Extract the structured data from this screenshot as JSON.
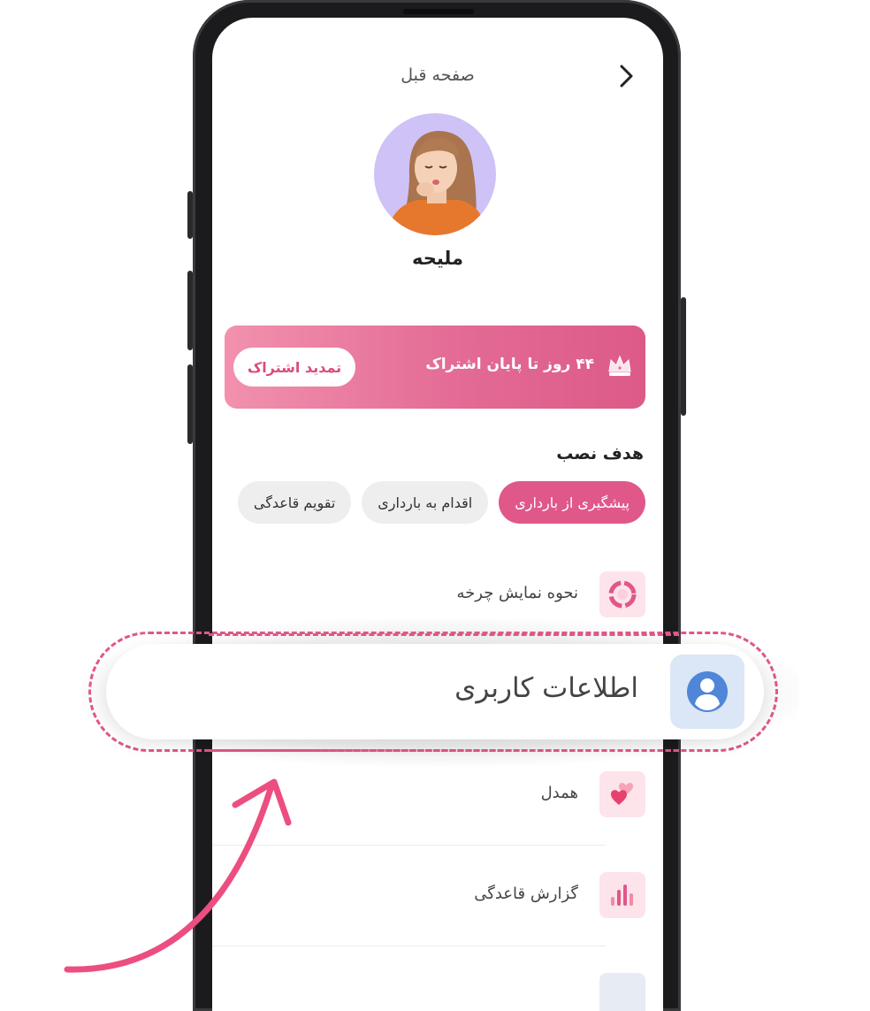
{
  "header": {
    "back_label": "صفحه قبل"
  },
  "profile": {
    "name": "ملیحه"
  },
  "subscription": {
    "status_text": "۴۴ روز تا پایان اشتراک",
    "renew_label": "تمدید اشتراک"
  },
  "goal": {
    "title": "هدف نصب",
    "chips": [
      {
        "label": "پیشگیری از بارداری",
        "active": true
      },
      {
        "label": "اقدام به بارداری",
        "active": false
      },
      {
        "label": "تقویم قاعدگی",
        "active": false
      }
    ]
  },
  "menu": {
    "items": [
      {
        "label": "نحوه نمایش چرخه",
        "icon": "cycle-icon"
      },
      {
        "label": "اطلاعات کاربری",
        "icon": "user-icon"
      },
      {
        "label": "همدل",
        "icon": "hearts-icon"
      },
      {
        "label": "گزارش قاعدگی",
        "icon": "bar-chart-icon"
      }
    ]
  },
  "colors": {
    "accent": "#e0578a",
    "banner_start": "#f291ae",
    "banner_end": "#dd5a88",
    "user_icon_bg": "#dbe6f7",
    "user_icon": "#4f86d8"
  }
}
